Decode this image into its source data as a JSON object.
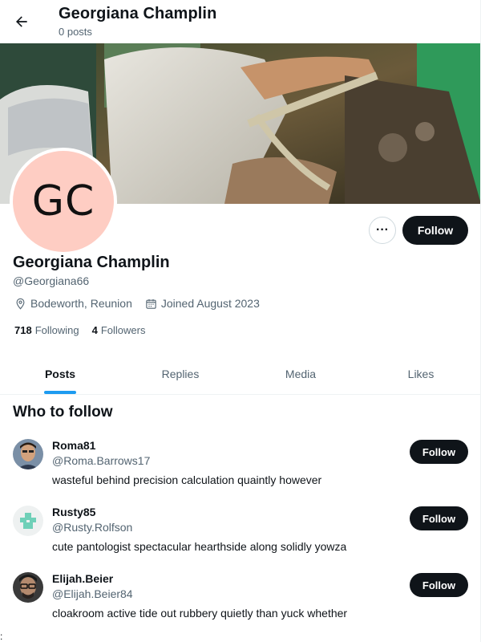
{
  "header": {
    "back_icon": "arrow-left-icon",
    "title": "Georgiana Champlin",
    "subtitle": "0 posts"
  },
  "profile": {
    "avatar_initials": "GC",
    "avatar_color": "#fecdc3",
    "name": "Georgiana Champlin",
    "handle": "@Georgiana66",
    "location": "Bodeworth, Reunion",
    "joined": "Joined August 2023",
    "following_count": "718",
    "following_label": "Following",
    "followers_count": "4",
    "followers_label": "Followers",
    "more_label": "···",
    "follow_label": "Follow"
  },
  "tabs": [
    {
      "label": "Posts",
      "active": true
    },
    {
      "label": "Replies",
      "active": false
    },
    {
      "label": "Media",
      "active": false
    },
    {
      "label": "Likes",
      "active": false
    }
  ],
  "who_to_follow": {
    "title": "Who to follow",
    "users": [
      {
        "name": "Roma81",
        "handle": "@Roma.Barrows17",
        "bio": "wasteful behind precision calculation quaintly however",
        "follow_label": "Follow"
      },
      {
        "name": "Rusty85",
        "handle": "@Rusty.Rolfson",
        "bio": "cute pantologist spectacular hearthside along solidly yowza",
        "follow_label": "Follow"
      },
      {
        "name": "Elijah.Beier",
        "handle": "@Elijah.Beier84",
        "bio": "cloakroom active tide out rubbery quietly than yuck whether",
        "follow_label": "Follow"
      }
    ]
  },
  "footer_text": ":",
  "colors": {
    "accent": "#1d9bf0",
    "button_dark": "#0f1419",
    "muted_text": "#536471"
  }
}
